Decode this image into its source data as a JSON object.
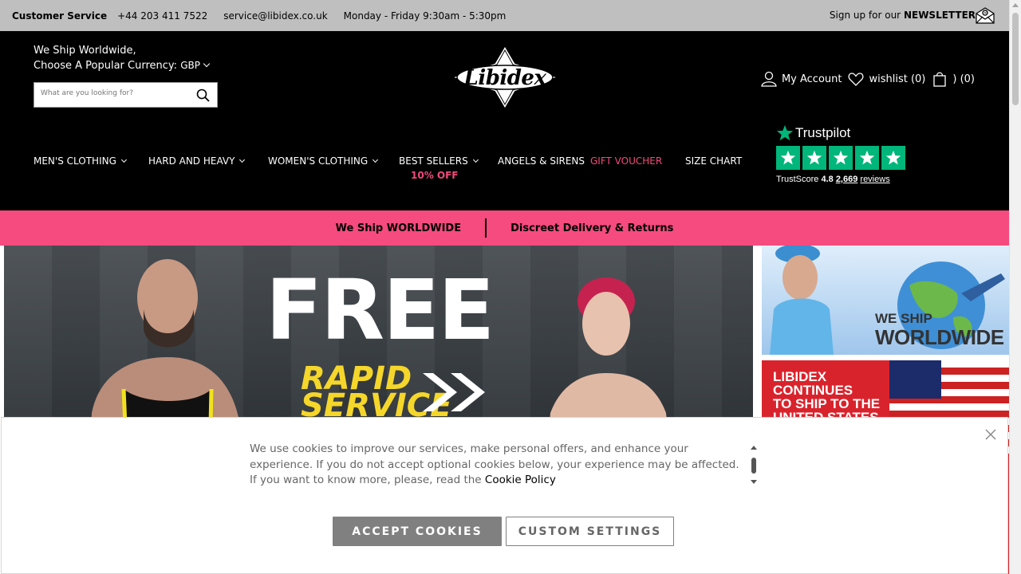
{
  "topbar": {
    "customer_service_label": "Customer Service",
    "phone": "+44 203 411 7522",
    "email": "service@libidex.co.uk",
    "hours": "Monday - Friday 9:30am - 5:30pm",
    "newsletter_prefix": "Sign up for our",
    "newsletter_word": "NEWSLETTER"
  },
  "header": {
    "ship_line": "We Ship Worldwide,",
    "currency_prompt": "Choose A Popular Currency:",
    "currency_value": "GBP",
    "search_placeholder": "What are you looking for?",
    "logo_text": "Libidex",
    "my_account": "My Account",
    "wishlist": "wishlist (0)",
    "cart": ") (0)"
  },
  "nav": {
    "items": [
      {
        "label": "MEN'S CLOTHING",
        "dropdown": true
      },
      {
        "label": "HARD AND HEAVY",
        "dropdown": true
      },
      {
        "label": "WOMEN'S CLOTHING",
        "dropdown": true
      },
      {
        "label": "BEST SELLERS",
        "dropdown": true,
        "sub": "10% OFF"
      },
      {
        "label": "ANGELS & SIRENS",
        "dropdown": false
      },
      {
        "label": "GIFT VOUCHER",
        "dropdown": false,
        "color": "#f04a7c"
      },
      {
        "label": "SIZE CHART",
        "dropdown": false
      }
    ]
  },
  "trustpilot": {
    "brand": "Trustpilot",
    "score_label": "TrustScore",
    "score": "4.8",
    "reviews_count": "2,669",
    "reviews_word": "reviews",
    "stars": 5
  },
  "promo_bar": {
    "left": "We Ship WORLDWIDE",
    "right": "Discreet Delivery & Returns"
  },
  "hero": {
    "headline": "FREE",
    "sub1": "RAPID",
    "sub2": "SERVICE"
  },
  "side_banners": {
    "top_line1": "WE SHIP",
    "top_line2": "WORLDWIDE",
    "bottom_line1": "LIBIDEX",
    "bottom_line2": "CONTINUES",
    "bottom_line3": "TO SHIP TO THE",
    "bottom_line4": "UNITED STATES"
  },
  "cookie": {
    "message": "We use cookies to improve our services, make personal offers, and enhance your experience. If you do not accept optional cookies below, your experience may be affected. If you want to know more, please, read the",
    "policy_link": "Cookie Policy",
    "accept_label": "ACCEPT COOKIES",
    "custom_label": "CUSTOM SETTINGS"
  },
  "colors": {
    "accent_pink": "#f54b7e",
    "trustpilot_green": "#00b67a",
    "header_bg": "#000000",
    "topbar_bg": "#bfbfbf"
  }
}
